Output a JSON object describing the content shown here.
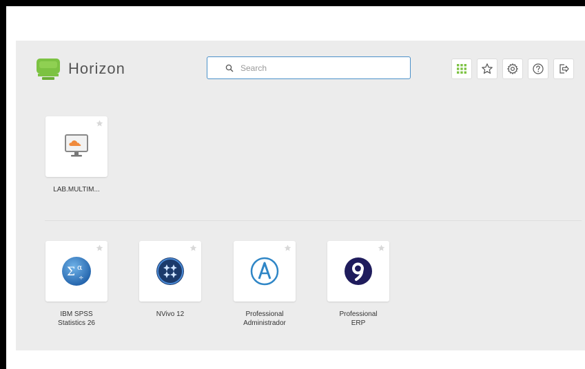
{
  "header": {
    "logo_text": "Horizon",
    "search_placeholder": "Search",
    "toolbar": [
      {
        "name": "apps-grid-button",
        "icon": "grid-icon"
      },
      {
        "name": "favorites-button",
        "icon": "star-icon"
      },
      {
        "name": "settings-button",
        "icon": "gear-icon"
      },
      {
        "name": "help-button",
        "icon": "help-icon"
      },
      {
        "name": "logout-button",
        "icon": "logout-icon"
      }
    ]
  },
  "desktops": [
    {
      "label": "LAB.MULTIM...",
      "icon": "cloud-desktop-icon"
    }
  ],
  "applications": [
    {
      "label": "IBM SPSS\nStatistics 26",
      "icon": "spss-icon"
    },
    {
      "label": "NVivo 12",
      "icon": "nvivo-icon"
    },
    {
      "label": "Professional\nAdministrador",
      "icon": "professional-admin-icon"
    },
    {
      "label": "Professional\nERP",
      "icon": "professional-erp-icon"
    }
  ],
  "colors": {
    "accent": "#4a90c9",
    "logo_green": "#7cc242",
    "background": "#ececec"
  }
}
